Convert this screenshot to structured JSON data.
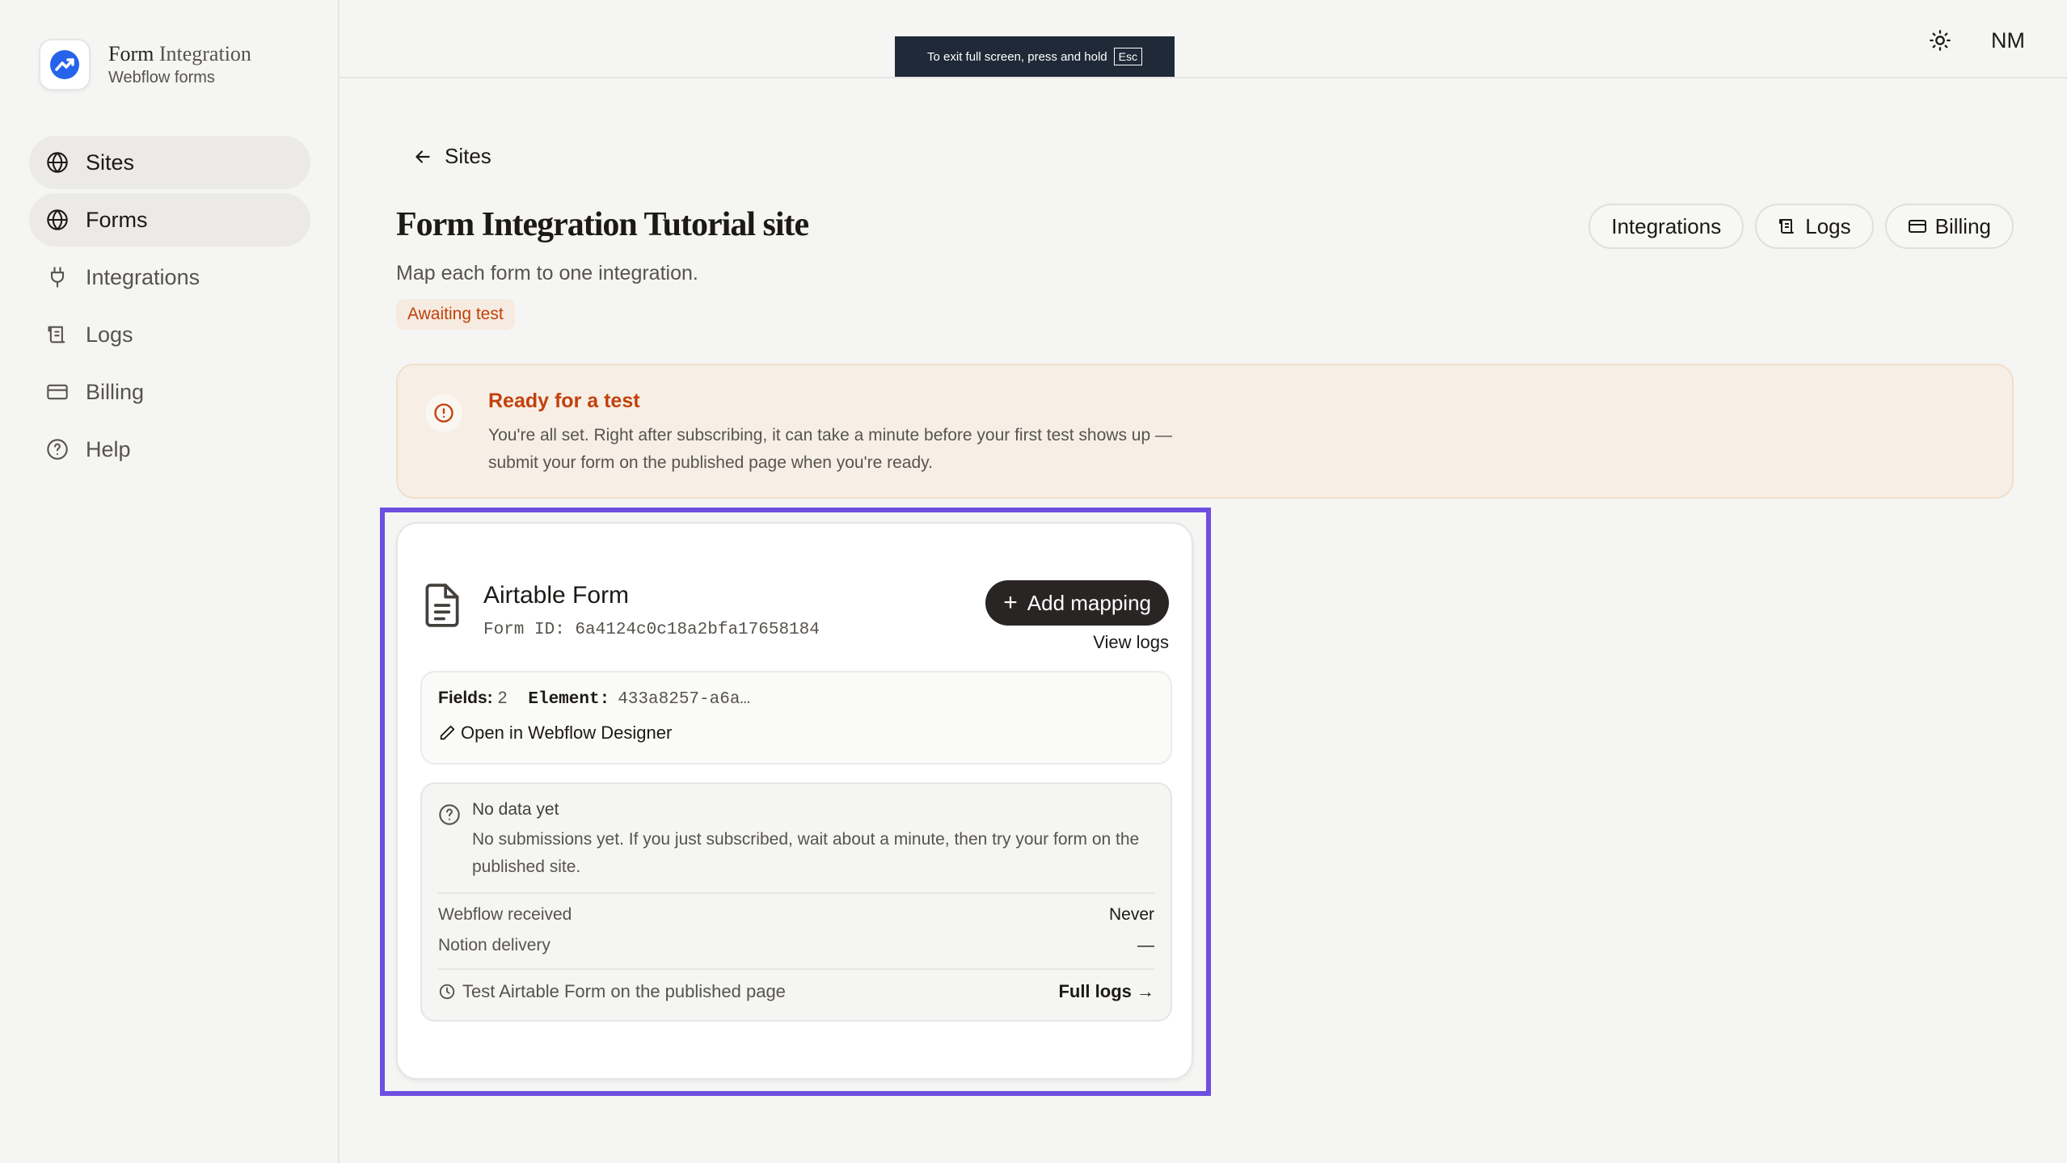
{
  "brand": {
    "title_main": "Form",
    "title_light": "Integration",
    "subtitle": "Webflow forms"
  },
  "sidebar": {
    "items": [
      {
        "label": "Sites",
        "icon": "globe-icon",
        "active": true
      },
      {
        "label": "Forms",
        "icon": "globe-icon",
        "active": true
      },
      {
        "label": "Integrations",
        "icon": "plug-icon",
        "active": false
      },
      {
        "label": "Logs",
        "icon": "scroll-icon",
        "active": false
      },
      {
        "label": "Billing",
        "icon": "credit-card-icon",
        "active": false
      },
      {
        "label": "Help",
        "icon": "help-circle-icon",
        "active": false
      }
    ]
  },
  "fullscreen_notice": {
    "text": "To exit full screen, press and hold",
    "key": "Esc"
  },
  "header": {
    "avatar_initials": "NM"
  },
  "page": {
    "back_label": "Sites",
    "title": "Form Integration Tutorial site",
    "subtitle": "Map each form to one integration.",
    "status_badge": "Awaiting test",
    "actions": {
      "integrations": "Integrations",
      "logs": "Logs",
      "billing": "Billing"
    }
  },
  "alert": {
    "title": "Ready for a test",
    "body": "You're all set. Right after subscribing, it can take a minute before your first test shows up — submit your form on the published page when you're ready."
  },
  "form_card": {
    "name": "Airtable Form",
    "form_id": "Form ID: 6a4124c0c18a2bfa17658184",
    "add_mapping": "Add mapping",
    "view_logs": "View logs",
    "fields_label": "Fields:",
    "fields_value": "2",
    "element_label": "Element:",
    "element_value": "433a8257-a6a…",
    "designer_link": "Open in Webflow Designer",
    "nodata_title": "No data yet",
    "nodata_body": "No submissions yet. If you just subscribed, wait about a minute, then try your form on the published site.",
    "webflow_received_label": "Webflow received",
    "webflow_received_value": "Never",
    "notion_delivery_label": "Notion delivery",
    "notion_delivery_value": "—",
    "test_hint": "Test Airtable Form on the published page",
    "full_logs": "Full logs →"
  },
  "colors": {
    "accent": "#6d4fe0",
    "warning": "#c2410c",
    "dark_button": "#292524",
    "logo_blue": "#2563eb"
  }
}
